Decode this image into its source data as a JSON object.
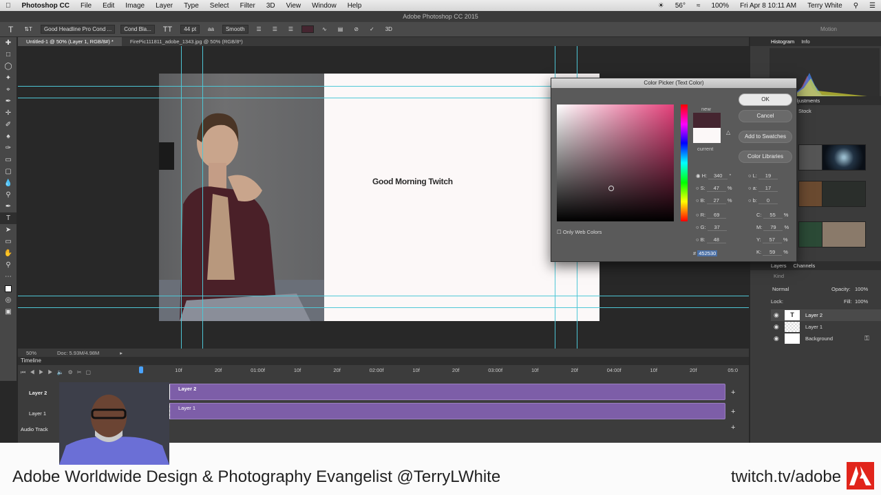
{
  "menubar": {
    "app": "Photoshop CC",
    "items": [
      "File",
      "Edit",
      "Image",
      "Layer",
      "Type",
      "Select",
      "Filter",
      "3D",
      "View",
      "Window",
      "Help"
    ],
    "status": [
      "56°",
      "100%",
      "Fri Apr 8  10:11 AM",
      "Terry White"
    ]
  },
  "window": {
    "title": "Adobe Photoshop CC 2015"
  },
  "options": {
    "font_family": "Good Headline Pro Cond ...",
    "font_style": "Cond Bla...",
    "font_size": "44 pt",
    "antialias": "Smooth",
    "workspace": "Motion"
  },
  "tabs": [
    {
      "label": "Untitled-1 @ 50% (Layer 1, RGB/8#) *"
    },
    {
      "label": "FirePic111811_adobe_1343.jpg @ 50% (RGB/8*)"
    }
  ],
  "document": {
    "headline": "Good Morning Twitch"
  },
  "status": {
    "zoom": "50%",
    "doc_size": "Doc: 5.93M/4.98M"
  },
  "timeline": {
    "title": "Timeline",
    "ticks": [
      "10f",
      "20f",
      "01:00f",
      "10f",
      "20f",
      "02:00f",
      "10f",
      "20f",
      "03:00f",
      "10f",
      "20f",
      "04:00f",
      "10f",
      "20f",
      "05:0"
    ],
    "tracks": [
      {
        "name": "Layer 2",
        "clip": "Layer 2"
      },
      {
        "name": "Layer 1",
        "clip": "Layer 1"
      },
      {
        "name": "Audio Track"
      }
    ]
  },
  "color_picker": {
    "title": "Color Picker (Text Color)",
    "new_label": "new",
    "current_label": "current",
    "new_color": "#452530",
    "current_color": "#fcf8f8",
    "buttons": {
      "ok": "OK",
      "cancel": "Cancel",
      "swatches": "Add to Swatches",
      "libraries": "Color Libraries"
    },
    "only_web": "Only Web Colors",
    "H": "340",
    "S": "47",
    "B": "27",
    "R": "69",
    "G": "37",
    "Bv": "48",
    "L": "19",
    "a": "17",
    "b": "0",
    "C": "55",
    "M": "79",
    "Y": "57",
    "K": "59",
    "hex": "452530",
    "deg": "°",
    "pct": "%"
  },
  "panels": {
    "histogram": [
      "Histogram",
      "Info"
    ],
    "libraries": [
      "Adjustments"
    ],
    "stock": "Stock",
    "layers_tabs": [
      "Layers",
      "Channels"
    ],
    "kind": "Kind",
    "blend": "Normal",
    "opacity_label": "Opacity:",
    "opacity": "100%",
    "lock_label": "Lock:",
    "fill_label": "Fill:",
    "fill": "100%",
    "layers": [
      "Layer 2",
      "Layer 1",
      "Background"
    ]
  },
  "banner": {
    "text": "Adobe Worldwide Design & Photography Evangelist @TerryLWhite",
    "url": "twitch.tv/adobe"
  }
}
